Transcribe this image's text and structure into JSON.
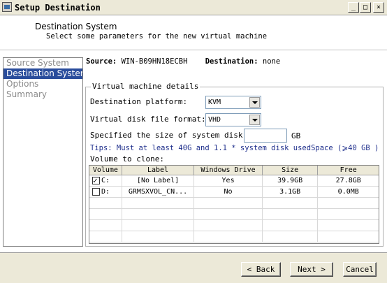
{
  "window": {
    "title": "Setup Destination",
    "controls": {
      "minimize": "_",
      "maximize": "□",
      "close": "×"
    }
  },
  "header": {
    "title": "Destination System",
    "subtitle": "Select some parameters for the new virtual machine"
  },
  "steps": [
    {
      "label": "Source System",
      "active": false
    },
    {
      "label": "Destination System",
      "active": true
    },
    {
      "label": "Options",
      "active": false
    },
    {
      "label": "Summary",
      "active": false
    }
  ],
  "info": {
    "source_label": "Source:",
    "source_value": "WIN-B09HN18ECBH",
    "destination_label": "Destination:",
    "destination_value": "none"
  },
  "details": {
    "legend": "Virtual machine details",
    "platform_label": "Destination platform:",
    "platform_value": "KVM",
    "disk_format_label": "Virtual disk file format:",
    "disk_format_value": "VHD",
    "disk_size_label": "Specified the size of system disk:",
    "disk_size_value": "",
    "disk_size_unit": "GB",
    "tips": "Tips: Must at least 40G and 1.1 * system disk usedSpace (⩾40 GB )",
    "volume_label": "Volume to clone:"
  },
  "table": {
    "columns": [
      "Volume",
      "Label",
      "Windows Drive",
      "Size",
      "Free"
    ],
    "rows": [
      {
        "checked": true,
        "volume": "C:",
        "label": "[No Label]",
        "windows_drive": "Yes",
        "size": "39.9GB",
        "free": "27.8GB"
      },
      {
        "checked": false,
        "volume": "D:",
        "label": "GRMSXVOL_CN...",
        "windows_drive": "No",
        "size": "3.1GB",
        "free": "0.0MB"
      }
    ]
  },
  "buttons": {
    "back": "< Back",
    "next": "Next >",
    "cancel": "Cancel"
  }
}
